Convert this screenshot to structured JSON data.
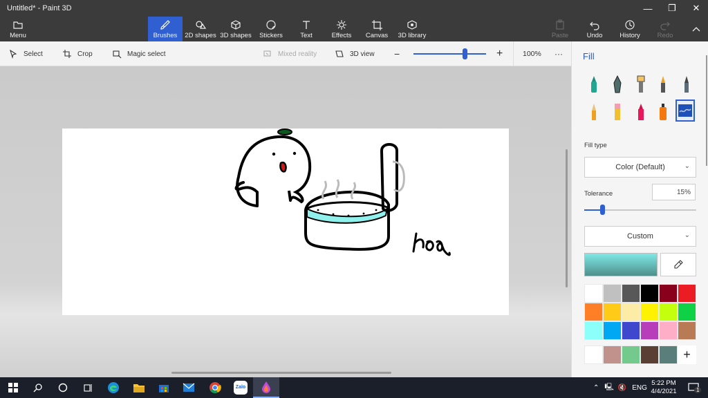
{
  "window": {
    "title": "Untitled* - Paint 3D"
  },
  "ribbon": [
    {
      "key": "menu",
      "label": "Menu"
    },
    {
      "key": "brushes",
      "label": "Brushes"
    },
    {
      "key": "shapes2d",
      "label": "2D shapes"
    },
    {
      "key": "shapes3d",
      "label": "3D shapes"
    },
    {
      "key": "stickers",
      "label": "Stickers"
    },
    {
      "key": "text",
      "label": "Text"
    },
    {
      "key": "effects",
      "label": "Effects"
    },
    {
      "key": "canvas",
      "label": "Canvas"
    },
    {
      "key": "library3d",
      "label": "3D library"
    },
    {
      "key": "paste",
      "label": "Paste"
    },
    {
      "key": "undo",
      "label": "Undo"
    },
    {
      "key": "history",
      "label": "History"
    },
    {
      "key": "redo",
      "label": "Redo"
    }
  ],
  "toolbar": {
    "select": "Select",
    "crop": "Crop",
    "magic_select": "Magic select",
    "mixed_reality": "Mixed reality",
    "view3d": "3D view",
    "zoom_level": "100%",
    "zoom_fraction": 0.7,
    "more": "···"
  },
  "panel": {
    "title": "Fill",
    "fill_type_label": "Fill type",
    "fill_type_value": "Color (Default)",
    "tolerance_label": "Tolerance",
    "tolerance_value": "15%",
    "color_mode": "Custom",
    "current_color": "#7fe9e6",
    "palette": [
      "#ffffff",
      "#c0c0c0",
      "#585858",
      "#000000",
      "#88001b",
      "#ec1c24",
      "#ff7f27",
      "#ffca18",
      "#fdeca6",
      "#fff200",
      "#c4ff0e",
      "#0ed145",
      "#8cfffb",
      "#00a8f3",
      "#3f48cc",
      "#b83dba",
      "#ffaec8",
      "#b97a56"
    ],
    "custom_palette": [
      "#ffffff",
      "#c0928b",
      "#74c98c",
      "#5a3f35",
      "#5a7f7a"
    ],
    "add_color_label": "+"
  },
  "drawing": {
    "signature": "hoa"
  },
  "taskbar": {
    "apps": [
      "start-icon",
      "search-icon",
      "cortana-icon",
      "task-view-icon",
      "edge-icon",
      "file-explorer-icon",
      "store-icon",
      "mail-icon",
      "chrome-icon",
      "zalo-icon",
      "paint3d-icon"
    ],
    "zalo_label": "Zalo",
    "language": "ENG",
    "time": "5:22 PM",
    "date": "4/4/2021",
    "notifications": "1"
  }
}
